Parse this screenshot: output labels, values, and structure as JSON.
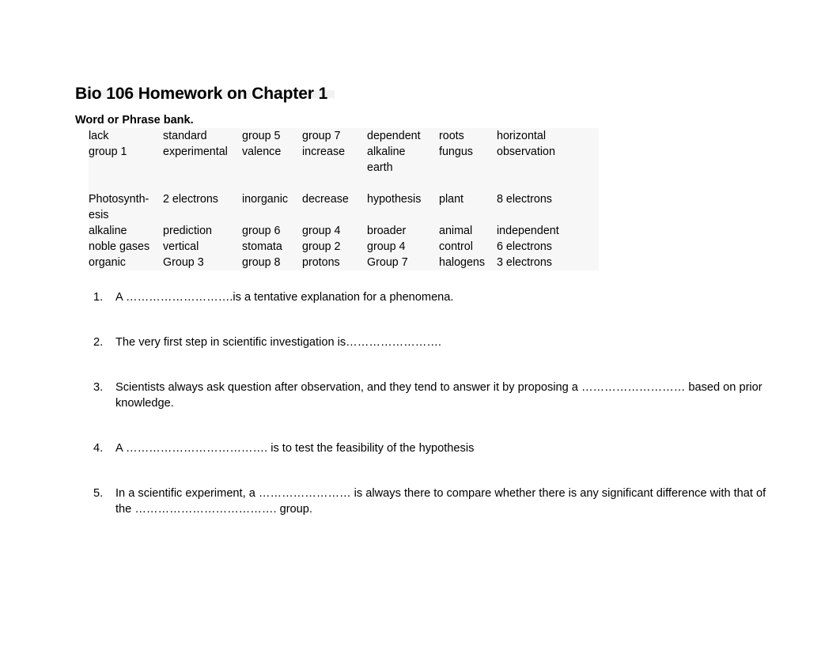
{
  "document": {
    "title": "Bio 106 Homework on Chapter 1",
    "section_label": "Word or Phrase bank."
  },
  "word_bank": {
    "columns": 7,
    "rows": [
      [
        "lack",
        "standard",
        "group 5",
        "group 7",
        "dependent",
        "roots",
        "horizontal"
      ],
      [
        "group 1",
        "experimental",
        "valence",
        "increase",
        "alkaline\nearth",
        "fungus",
        "observation"
      ],
      [
        "Photosynth-\nesis",
        "2 electrons",
        "inorganic",
        "decrease",
        "hypothesis",
        "plant",
        "8 electrons"
      ],
      [
        "alkaline",
        "prediction",
        "group 6",
        "group 4",
        "broader",
        "animal",
        "independent"
      ],
      [
        "noble gases",
        "vertical",
        "stomata",
        "group 2",
        "group 4",
        "control",
        "6 electrons"
      ],
      [
        "organic",
        "Group 3",
        "group 8",
        "protons",
        "Group 7",
        "halogens",
        "3 electrons"
      ]
    ]
  },
  "questions": [
    {
      "number": "1.",
      "text": "A ……………………….is a tentative explanation for a phenomena."
    },
    {
      "number": "2.",
      "text": "The very first step in scientific investigation is……………………."
    },
    {
      "number": "3.",
      "text": "Scientists always ask question after observation, and they tend to answer it by proposing a ……………………… based on prior knowledge."
    },
    {
      "number": "4.",
      "text": "A ………………………………. is to test the feasibility of the hypothesis"
    },
    {
      "number": "5.",
      "text": "In a scientific experiment, a …………………… is always there to compare whether there is any significant difference with that of the ………………………………. group."
    }
  ],
  "colors": {
    "page_background": "#ffffff",
    "text": "#000000",
    "table_background": "#f7f7f7",
    "title_shade": "#f2f2f2"
  }
}
